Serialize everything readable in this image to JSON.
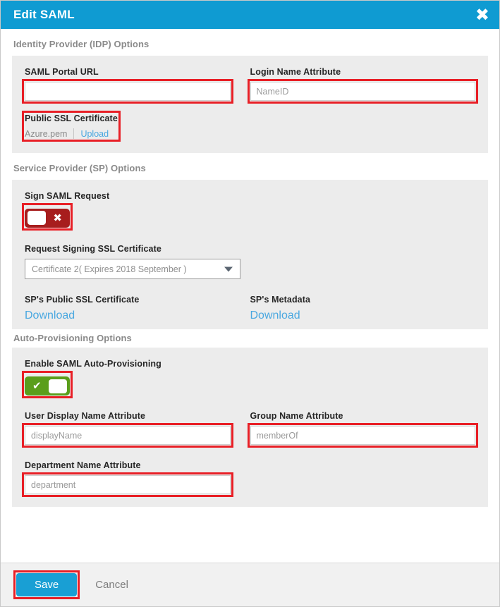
{
  "dialog": {
    "title": "Edit SAML",
    "close_icon": "close-icon"
  },
  "idp": {
    "section_title": "Identity Provider (IDP) Options",
    "portal_url": {
      "label": "SAML Portal URL",
      "value": "",
      "placeholder": ""
    },
    "login_name_attribute": {
      "label": "Login Name Attribute",
      "value": "",
      "placeholder": "NameID"
    },
    "public_ssl_certificate": {
      "label": "Public SSL Certificate",
      "file_name": "Azure.pem",
      "upload_link": "Upload"
    }
  },
  "sp": {
    "section_title": "Service Provider (SP) Options",
    "sign_saml_request": {
      "label": "Sign SAML Request",
      "state": "off",
      "glyph": "✖"
    },
    "request_signing_certificate": {
      "label": "Request Signing SSL Certificate",
      "selected": "Certificate 2( Expires 2018 September )"
    },
    "sp_public_ssl_certificate": {
      "label": "SP's Public SSL Certificate",
      "link": "Download"
    },
    "sp_metadata": {
      "label": "SP's Metadata",
      "link": "Download"
    }
  },
  "auto_provisioning": {
    "section_title": "Auto-Provisioning Options",
    "enable_toggle": {
      "label": "Enable SAML Auto-Provisioning",
      "state": "on",
      "glyph": "✔"
    },
    "user_display_name_attribute": {
      "label": "User Display Name Attribute",
      "value": "",
      "placeholder": "displayName"
    },
    "group_name_attribute": {
      "label": "Group Name Attribute",
      "value": "",
      "placeholder": "memberOf"
    },
    "department_name_attribute": {
      "label": "Department Name Attribute",
      "value": "",
      "placeholder": "department"
    }
  },
  "footer": {
    "save_label": "Save",
    "cancel_label": "Cancel"
  },
  "colors": {
    "header_blue": "#0f9bd2",
    "panel_gray": "#ececec",
    "annotation_red": "#e81f26",
    "toggle_off_red": "#a71d1d",
    "toggle_on_green": "#5a9e1b",
    "link_blue": "#4aa8e0",
    "save_blue": "#199fd4"
  }
}
